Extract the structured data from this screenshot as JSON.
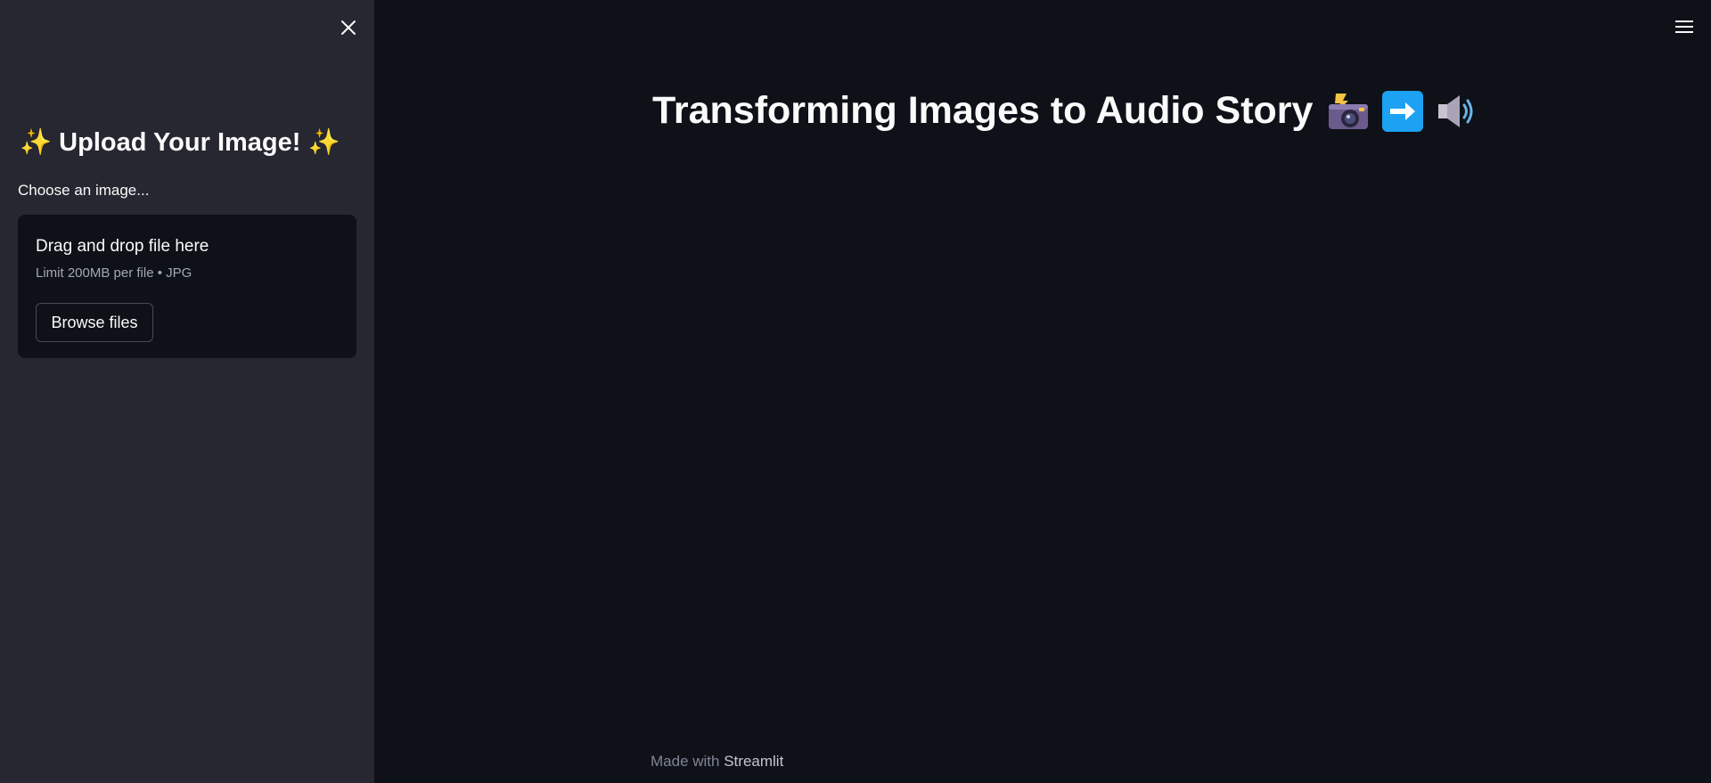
{
  "sidebar": {
    "title": "Upload Your Image!",
    "title_emoji": "sparkles",
    "uploader": {
      "label": "Choose an image...",
      "drop_text": "Drag and drop file here",
      "limit_text": "Limit 200MB per file • JPG",
      "browse_label": "Browse files"
    }
  },
  "main": {
    "title": "Transforming Images to Audio Story",
    "title_icons": [
      "camera-with-flash-icon",
      "right-arrow-icon",
      "speaker-high-volume-icon"
    ]
  },
  "footer": {
    "prefix": "Made with",
    "link": "Streamlit"
  },
  "colors": {
    "main_bg": "#0e1117",
    "sidebar_bg": "#262730",
    "text": "#fafafa",
    "arrow_blue": "#1da1f2"
  }
}
